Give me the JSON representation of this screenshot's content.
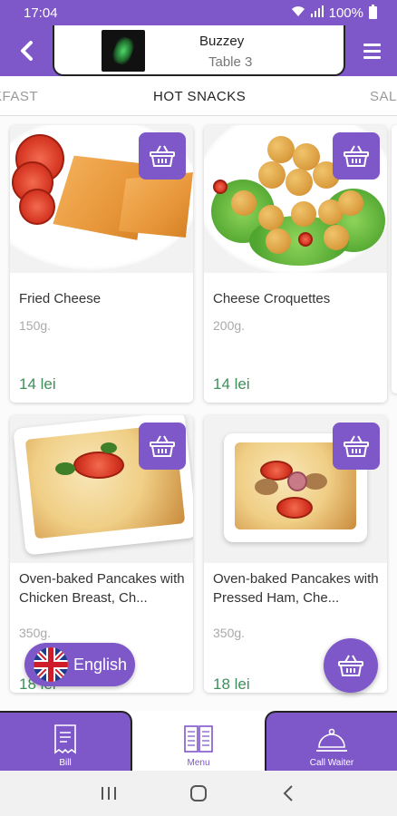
{
  "status_bar": {
    "time": "17:04",
    "battery": "100%"
  },
  "header": {
    "venue_name": "Buzzey",
    "table": "Table 3"
  },
  "tabs": {
    "left": "KFAST",
    "active": "HOT SNACKS",
    "right": "SAL"
  },
  "products": [
    {
      "name": "Fried Cheese",
      "weight": "150g.",
      "price": "14 lei"
    },
    {
      "name": "Cheese Croquettes",
      "weight": "200g.",
      "price": "14 lei"
    },
    {
      "name": "Oven-baked Pancakes with Chicken Breast, Ch...",
      "weight": "350g.",
      "price": "18 lei"
    },
    {
      "name": "Oven-baked Pancakes with Pressed Ham, Che...",
      "weight": "350g.",
      "price": "18 lei"
    }
  ],
  "language": {
    "label": "English"
  },
  "bottom_nav": {
    "bill": "Bill",
    "menu": "Menu",
    "call_waiter": "Call Waiter"
  },
  "colors": {
    "primary": "#7e57c9",
    "price": "#3f8f5a"
  },
  "icons": [
    "back-icon",
    "hamburger-icon",
    "basket-icon",
    "uk-flag-icon",
    "receipt-icon",
    "menu-book-icon",
    "cloche-icon"
  ]
}
